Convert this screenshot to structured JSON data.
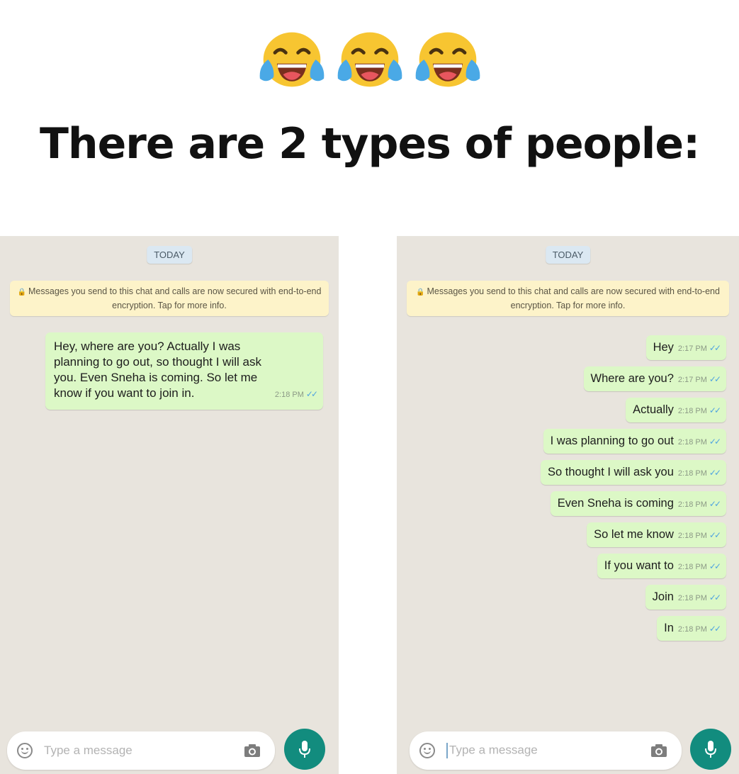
{
  "headline": "There are 2 types of people:",
  "icons": {
    "emoji": "face-with-tears-of-joy-icon",
    "lock": "lock-icon",
    "smiley": "smiley-icon",
    "camera": "camera-icon",
    "mic": "microphone-icon",
    "ticks": "double-check-icon"
  },
  "colors": {
    "chat_background": "#e8e4dd",
    "outgoing_bubble": "#dcf8c6",
    "notice_background": "#fdf3c9",
    "send_button": "#128c7e",
    "ticks": "#4fa3e0"
  },
  "left_chat": {
    "date_label": "TODAY",
    "notice": "Messages you send to this chat and calls are now secured with end-to-end encryption. Tap for more info.",
    "message": {
      "lines": [
        "Hey, where are you? Actually I was",
        "planning to go out, so thought I will ask",
        "you. Even Sneha is coming. So let me",
        "know if you want to join in."
      ],
      "time": "2:18 PM"
    },
    "composer_placeholder": "Type a message"
  },
  "right_chat": {
    "date_label": "TODAY",
    "notice": "Messages you send to this chat and calls are now secured with end-to-end encryption. Tap for more info.",
    "messages": [
      {
        "text": "Hey",
        "time": "2:17 PM"
      },
      {
        "text": "Where are you?",
        "time": "2:17 PM"
      },
      {
        "text": "Actually",
        "time": "2:18 PM"
      },
      {
        "text": "I was planning to go out",
        "time": "2:18 PM"
      },
      {
        "text": "So thought I will ask you",
        "time": "2:18 PM"
      },
      {
        "text": "Even Sneha is coming",
        "time": "2:18 PM"
      },
      {
        "text": "So let me know",
        "time": "2:18 PM"
      },
      {
        "text": "If you want to",
        "time": "2:18 PM"
      },
      {
        "text": "Join",
        "time": "2:18 PM"
      },
      {
        "text": "In",
        "time": "2:18 PM"
      }
    ],
    "composer_placeholder": "Type a message"
  }
}
